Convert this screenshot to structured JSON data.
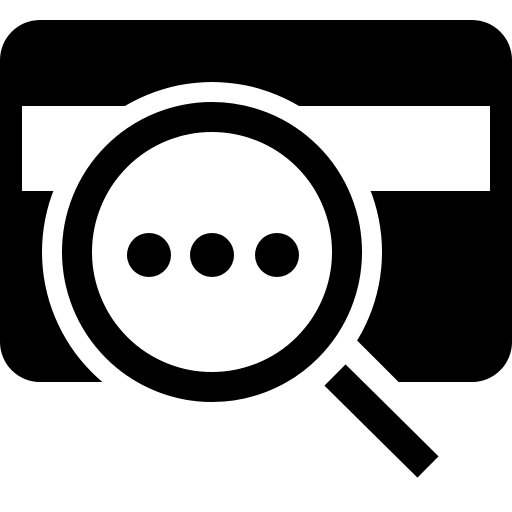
{
  "icon": {
    "name": "card-search-icon",
    "foreground": "#000000",
    "background": "#ffffff",
    "dots": 3
  }
}
